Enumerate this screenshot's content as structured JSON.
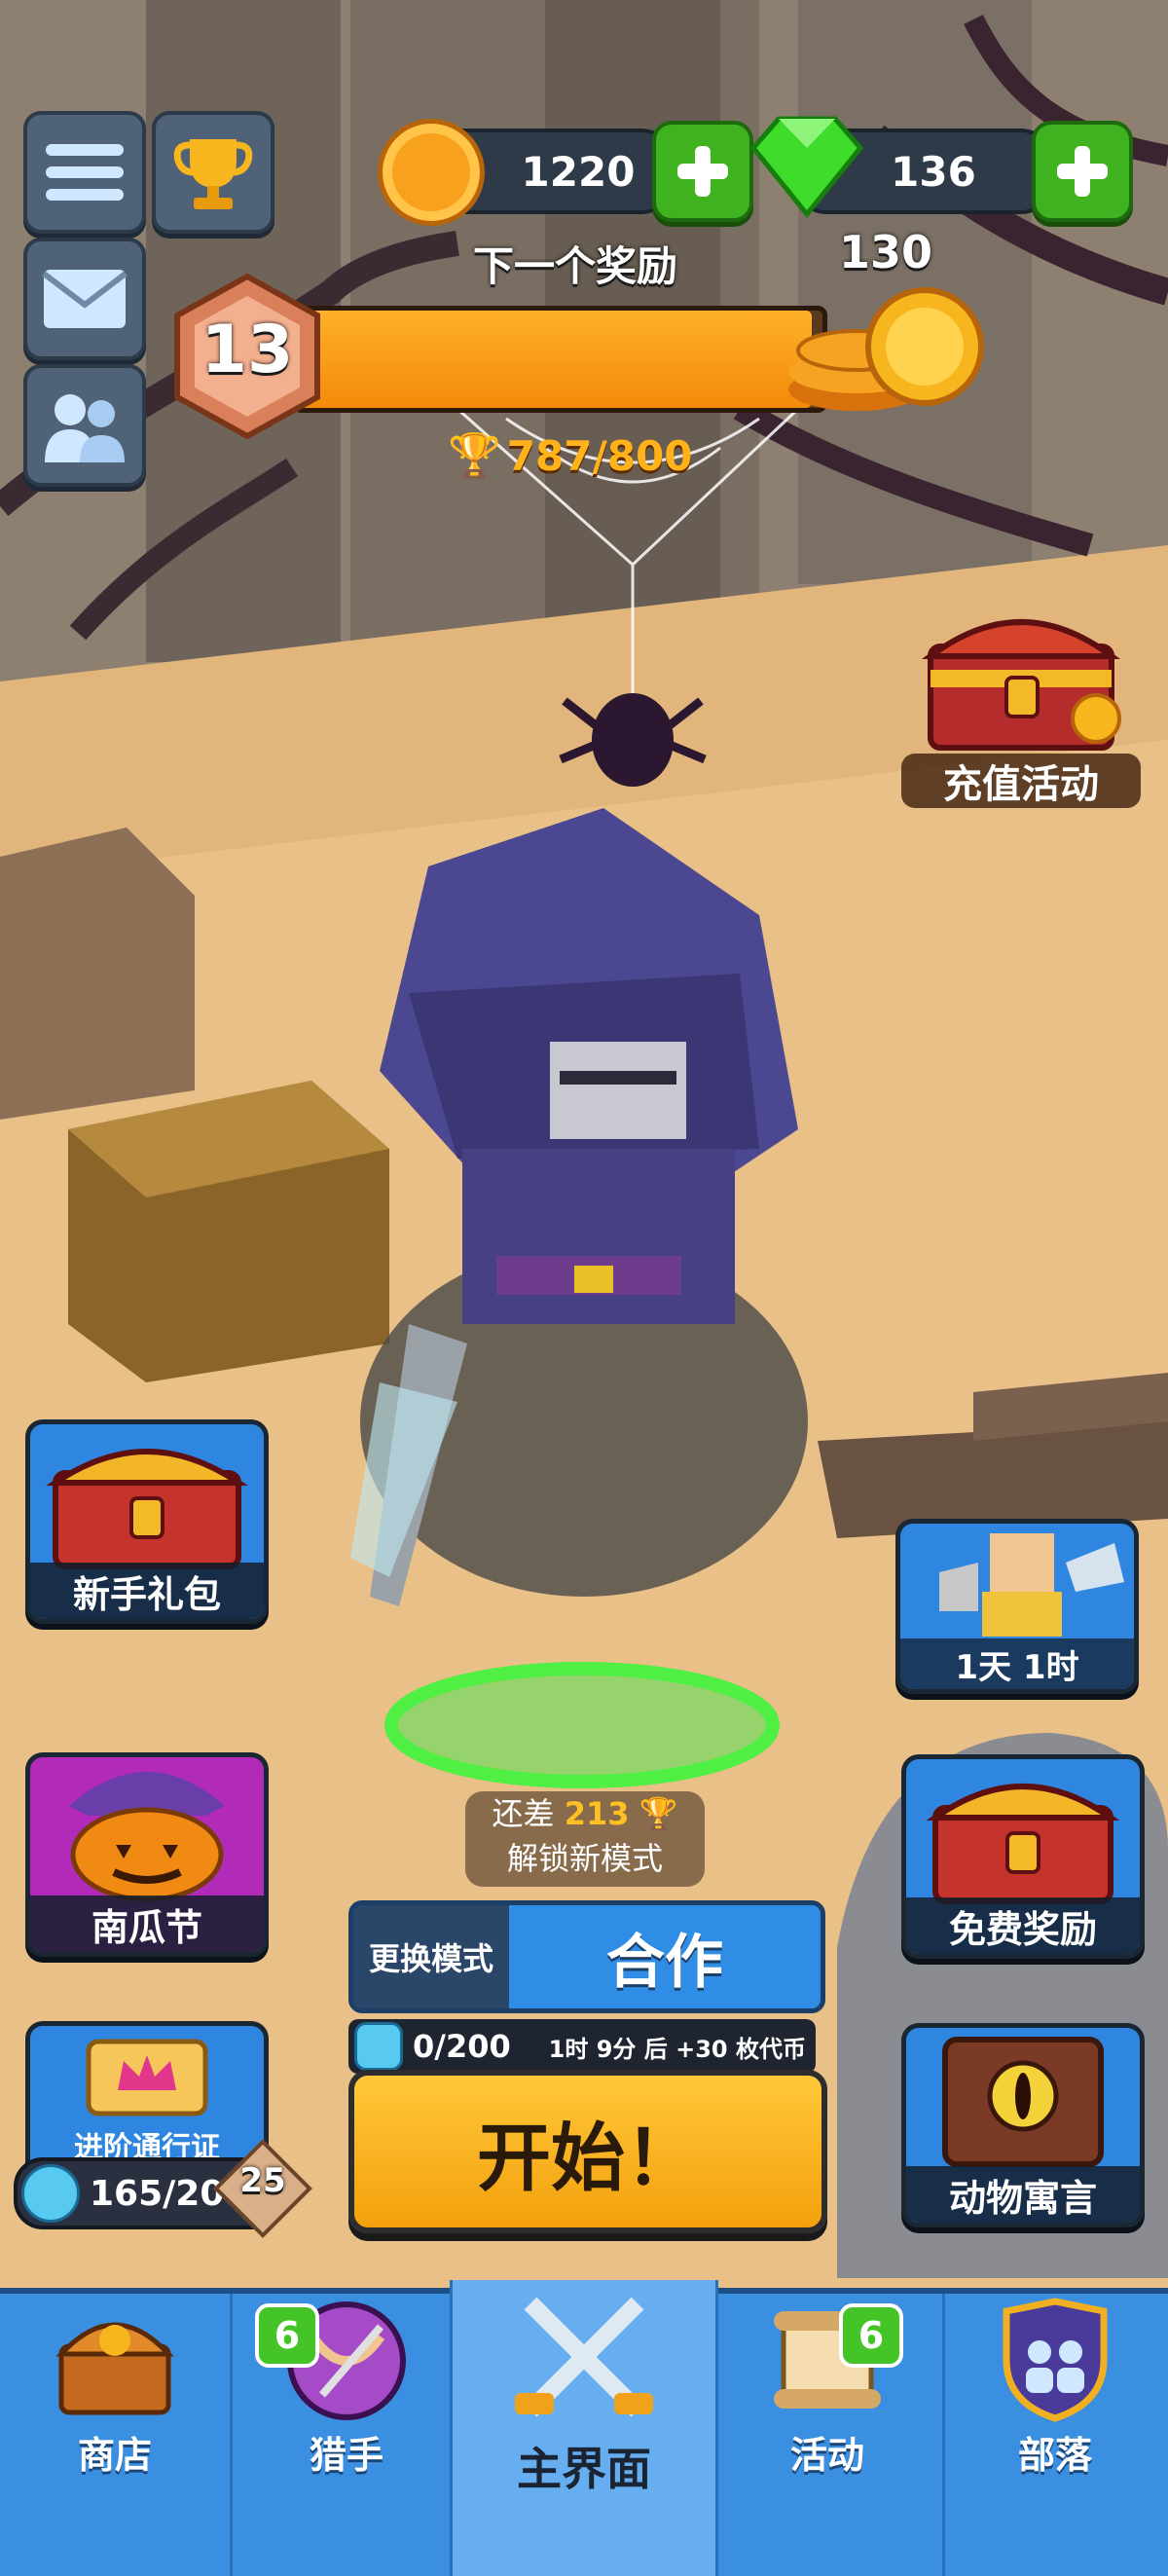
{
  "currency": {
    "coins": "1220",
    "gems": "136"
  },
  "progress": {
    "next_reward_label": "下一个奖励",
    "reward_amount": "130",
    "level": "13",
    "trophies": "787/800",
    "fill_fraction": 0.98
  },
  "events": {
    "recharge_label": "充值活动",
    "starter_pack_label": "新手礼包",
    "timer_label": "1天 1时",
    "pumpkin_label": "南瓜节",
    "free_reward_label": "免费奖励",
    "fable_label": "动物寓言",
    "pass_label": "进阶通行证",
    "pass_progress": "165/200",
    "pass_level": "25"
  },
  "unlock": {
    "prefix": "还差",
    "amount": "213",
    "text": "解锁新模式"
  },
  "mode": {
    "change_label": "更换模式",
    "current_mode": "合作",
    "energy": "0/200",
    "refill_time": "1时 9分 后",
    "refill_amount": "+30",
    "refill_suffix": "枚代币",
    "start_label": "开始！"
  },
  "nav": {
    "items": [
      {
        "label": "商店",
        "badge": ""
      },
      {
        "label": "猎手",
        "badge": "6"
      },
      {
        "label": "主界面",
        "badge": ""
      },
      {
        "label": "活动",
        "badge": "6"
      },
      {
        "label": "部落",
        "badge": ""
      }
    ],
    "active_index": 2
  },
  "colors": {
    "accent_orange": "#ff9a12",
    "gem_green": "#3fdc2c",
    "nav_blue": "#3a8fe0",
    "button_green": "#3fb21f"
  }
}
